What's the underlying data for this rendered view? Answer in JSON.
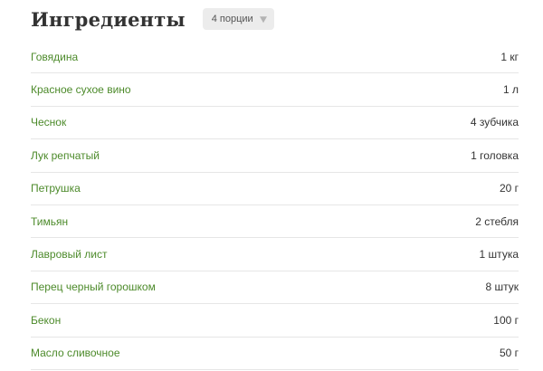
{
  "header": {
    "title": "Ингредиенты",
    "servings_label": "4 порции"
  },
  "ingredients": [
    {
      "name": "Говядина",
      "quantity": "1 кг"
    },
    {
      "name": "Красное сухое вино",
      "quantity": "1 л"
    },
    {
      "name": "Чеснок",
      "quantity": "4 зубчика"
    },
    {
      "name": "Лук репчатый",
      "quantity": "1 головка"
    },
    {
      "name": "Петрушка",
      "quantity": "20 г"
    },
    {
      "name": "Тимьян",
      "quantity": "2 стебля"
    },
    {
      "name": "Лавровый лист",
      "quantity": "1 штука"
    },
    {
      "name": "Перец черный горошком",
      "quantity": "8 штук"
    },
    {
      "name": "Бекон",
      "quantity": "100 г"
    },
    {
      "name": "Масло сливочное",
      "quantity": "50 г"
    }
  ],
  "colors": {
    "link_green": "#4c8a2a",
    "text_dark": "#333333",
    "divider": "#e6e6e6",
    "select_bg": "#ececec"
  }
}
